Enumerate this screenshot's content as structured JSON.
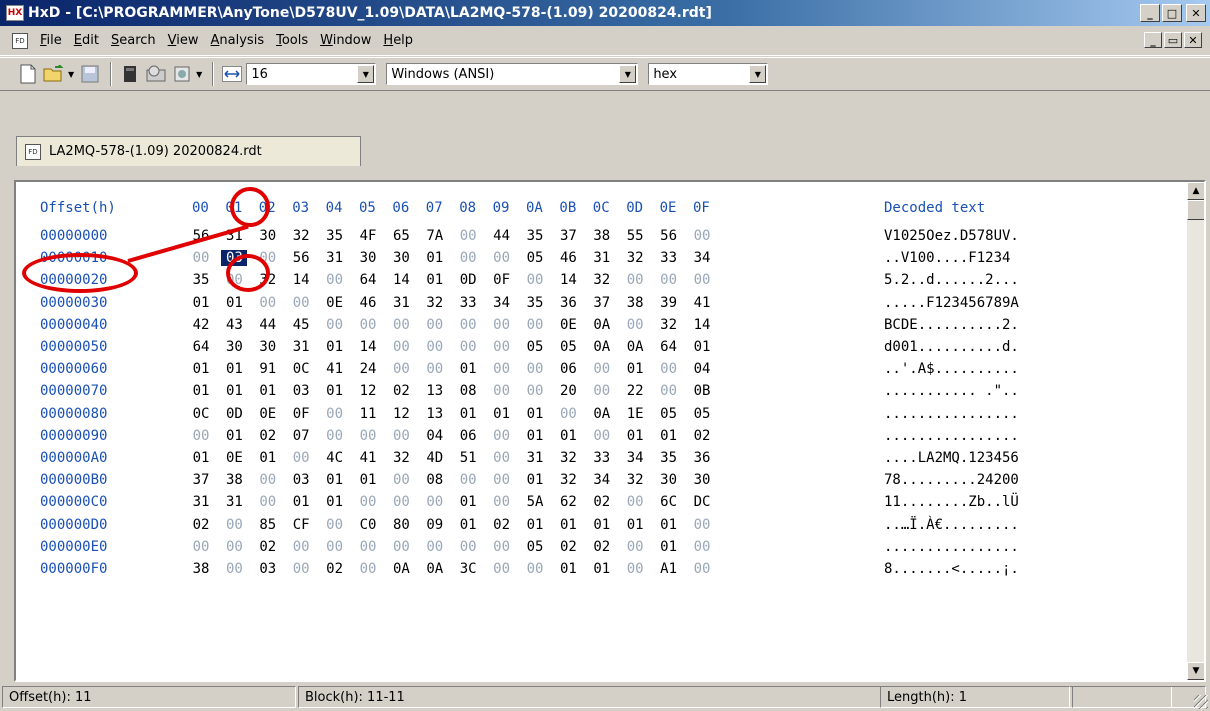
{
  "window": {
    "title": "HxD - [C:\\PROGRAMMER\\AnyTone\\D578UV_1.09\\DATA\\LA2MQ-578-(1.09) 20200824.rdt]",
    "app_icon": "hxd-app-icon",
    "minimize": "_",
    "maximize": "□",
    "close": "✕"
  },
  "menu": {
    "items": [
      {
        "label": "File",
        "underline": "F"
      },
      {
        "label": "Edit",
        "underline": "E"
      },
      {
        "label": "Search",
        "underline": "S"
      },
      {
        "label": "View",
        "underline": "V"
      },
      {
        "label": "Analysis",
        "underline": "A"
      },
      {
        "label": "Tools",
        "underline": "T"
      },
      {
        "label": "Window",
        "underline": "W"
      },
      {
        "label": "Help",
        "underline": "H"
      }
    ],
    "mdi_min": "_",
    "mdi_restore": "▭",
    "mdi_close": "✕"
  },
  "toolbar": {
    "bytes_per_row": "16",
    "charset": "Windows (ANSI)",
    "display_mode": "hex"
  },
  "tab": {
    "label": "LA2MQ-578-(1.09) 20200824.rdt"
  },
  "hex": {
    "offset_header": "Offset(h)",
    "column_headers": [
      "00",
      "01",
      "02",
      "03",
      "04",
      "05",
      "06",
      "07",
      "08",
      "09",
      "0A",
      "0B",
      "0C",
      "0D",
      "0E",
      "0F"
    ],
    "decoded_header": "Decoded text",
    "rows": [
      {
        "offset": "00000000",
        "bytes": [
          "56",
          "31",
          "30",
          "32",
          "35",
          "4F",
          "65",
          "7A",
          "00",
          "44",
          "35",
          "37",
          "38",
          "55",
          "56",
          "00"
        ],
        "decoded": "V1025Oez.D578UV."
      },
      {
        "offset": "00000010",
        "bytes": [
          "00",
          "03",
          "00",
          "56",
          "31",
          "30",
          "30",
          "01",
          "00",
          "00",
          "05",
          "46",
          "31",
          "32",
          "33",
          "34"
        ],
        "decoded": "..V100....F1234"
      },
      {
        "offset": "00000020",
        "bytes": [
          "35",
          "00",
          "32",
          "14",
          "00",
          "64",
          "14",
          "01",
          "0D",
          "0F",
          "00",
          "14",
          "32",
          "00",
          "00",
          "00"
        ],
        "decoded": "5.2..d......2..."
      },
      {
        "offset": "00000030",
        "bytes": [
          "01",
          "01",
          "00",
          "00",
          "0E",
          "46",
          "31",
          "32",
          "33",
          "34",
          "35",
          "36",
          "37",
          "38",
          "39",
          "41"
        ],
        "decoded": ".....F123456789A"
      },
      {
        "offset": "00000040",
        "bytes": [
          "42",
          "43",
          "44",
          "45",
          "00",
          "00",
          "00",
          "00",
          "00",
          "00",
          "00",
          "0E",
          "0A",
          "00",
          "32",
          "14"
        ],
        "decoded": "BCDE..........2."
      },
      {
        "offset": "00000050",
        "bytes": [
          "64",
          "30",
          "30",
          "31",
          "01",
          "14",
          "00",
          "00",
          "00",
          "00",
          "05",
          "05",
          "0A",
          "0A",
          "64",
          "01"
        ],
        "decoded": "d001..........d."
      },
      {
        "offset": "00000060",
        "bytes": [
          "01",
          "01",
          "91",
          "0C",
          "41",
          "24",
          "00",
          "00",
          "01",
          "00",
          "00",
          "06",
          "00",
          "01",
          "00",
          "04"
        ],
        "decoded": "..'.A$.........."
      },
      {
        "offset": "00000070",
        "bytes": [
          "01",
          "01",
          "01",
          "03",
          "01",
          "12",
          "02",
          "13",
          "08",
          "00",
          "00",
          "20",
          "00",
          "22",
          "00",
          "0B"
        ],
        "decoded": "........... .\".."
      },
      {
        "offset": "00000080",
        "bytes": [
          "0C",
          "0D",
          "0E",
          "0F",
          "00",
          "11",
          "12",
          "13",
          "01",
          "01",
          "01",
          "00",
          "0A",
          "1E",
          "05",
          "05"
        ],
        "decoded": "................"
      },
      {
        "offset": "00000090",
        "bytes": [
          "00",
          "01",
          "02",
          "07",
          "00",
          "00",
          "00",
          "04",
          "06",
          "00",
          "01",
          "01",
          "00",
          "01",
          "01",
          "02"
        ],
        "decoded": "................"
      },
      {
        "offset": "000000A0",
        "bytes": [
          "01",
          "0E",
          "01",
          "00",
          "4C",
          "41",
          "32",
          "4D",
          "51",
          "00",
          "31",
          "32",
          "33",
          "34",
          "35",
          "36"
        ],
        "decoded": "....LA2MQ.123456"
      },
      {
        "offset": "000000B0",
        "bytes": [
          "37",
          "38",
          "00",
          "03",
          "01",
          "01",
          "00",
          "08",
          "00",
          "00",
          "01",
          "32",
          "34",
          "32",
          "30",
          "30"
        ],
        "decoded": "78.........24200"
      },
      {
        "offset": "000000C0",
        "bytes": [
          "31",
          "31",
          "00",
          "01",
          "01",
          "00",
          "00",
          "00",
          "01",
          "00",
          "5A",
          "62",
          "02",
          "00",
          "6C",
          "DC"
        ],
        "decoded": "11........Zb..lÜ"
      },
      {
        "offset": "000000D0",
        "bytes": [
          "02",
          "00",
          "85",
          "CF",
          "00",
          "C0",
          "80",
          "09",
          "01",
          "02",
          "01",
          "01",
          "01",
          "01",
          "01",
          "00"
        ],
        "decoded": "..…Ï.À€........."
      },
      {
        "offset": "000000E0",
        "bytes": [
          "00",
          "00",
          "02",
          "00",
          "00",
          "00",
          "00",
          "00",
          "00",
          "00",
          "05",
          "02",
          "02",
          "00",
          "01",
          "00"
        ],
        "decoded": "................"
      },
      {
        "offset": "000000F0",
        "bytes": [
          "38",
          "00",
          "03",
          "00",
          "02",
          "00",
          "0A",
          "0A",
          "3C",
          "00",
          "00",
          "01",
          "01",
          "00",
          "A1",
          "00"
        ],
        "decoded": "8.......<.....¡."
      }
    ],
    "selected": {
      "row": 1,
      "col": 1
    }
  },
  "status": {
    "offset": "Offset(h): 11",
    "block": "Block(h): 11-11",
    "length": "Length(h): 1"
  },
  "colors": {
    "offset_blue": "#1a50b4",
    "zero_gray": "#9aa7b8",
    "annotation_red": "#e00000",
    "selection": "#0a246a"
  }
}
